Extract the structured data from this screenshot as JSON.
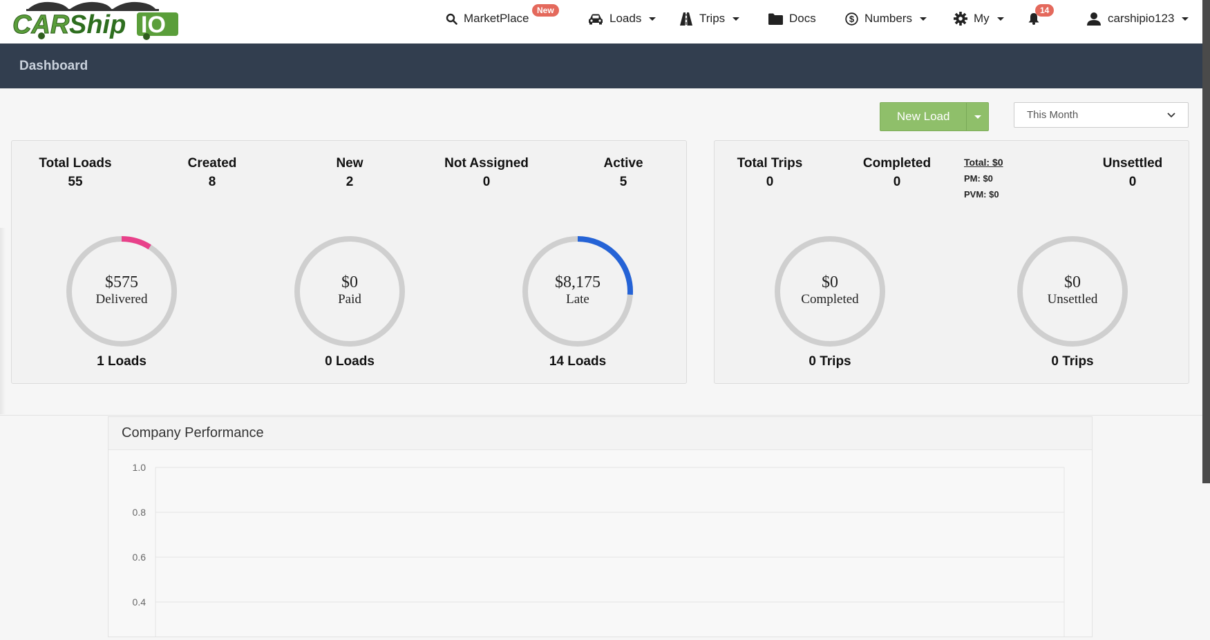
{
  "brand": {
    "logo_text": "CARShipIO"
  },
  "nav": {
    "marketplace": {
      "label": "MarketPlace",
      "badge": "New"
    },
    "loads": {
      "label": "Loads"
    },
    "trips": {
      "label": "Trips"
    },
    "docs": {
      "label": "Docs"
    },
    "numbers": {
      "label": "Numbers"
    },
    "my": {
      "label": "My"
    },
    "notifications": {
      "badge": "14"
    },
    "user": {
      "label": "carshipio123"
    }
  },
  "page": {
    "title": "Dashboard"
  },
  "actions": {
    "new_load_label": "New Load",
    "period_select": "This Month"
  },
  "loads_stats": [
    {
      "label": "Total Loads",
      "value": "55"
    },
    {
      "label": "Created",
      "value": "8"
    },
    {
      "label": "New",
      "value": "2"
    },
    {
      "label": "Not Assigned",
      "value": "0"
    },
    {
      "label": "Active",
      "value": "5"
    }
  ],
  "loads_gauges": [
    {
      "amount": "$575",
      "caption": "Delivered",
      "footer": "1 Loads",
      "color": "#e8418a",
      "fraction": 0.09
    },
    {
      "amount": "$0",
      "caption": "Paid",
      "footer": "0 Loads",
      "color": "#cccccc",
      "fraction": 0
    },
    {
      "amount": "$8,175",
      "caption": "Late",
      "footer": "14 Loads",
      "color": "#2563d6",
      "fraction": 0.26
    }
  ],
  "trips_stats": [
    {
      "label": "Total Trips",
      "value": "0"
    },
    {
      "label": "Completed",
      "value": "0"
    },
    {
      "label": "Unsettled",
      "value": "0"
    }
  ],
  "trips_totals": {
    "total": "Total: $0",
    "pm": "PM: $0",
    "pvm": "PVM: $0"
  },
  "trips_gauges": [
    {
      "amount": "$0",
      "caption": "Completed",
      "footer": "0 Trips",
      "color": "#cccccc",
      "fraction": 0
    },
    {
      "amount": "$0",
      "caption": "Unsettled",
      "footer": "0 Trips",
      "color": "#cccccc",
      "fraction": 0
    }
  ],
  "performance": {
    "title": "Company Performance",
    "chart_data": {
      "type": "line",
      "title": "Company Performance",
      "yticks": [
        "1.0",
        "0.8",
        "0.6",
        "0.4"
      ],
      "ylim": [
        0.4,
        1.0
      ],
      "series": [],
      "grid": true
    }
  }
}
